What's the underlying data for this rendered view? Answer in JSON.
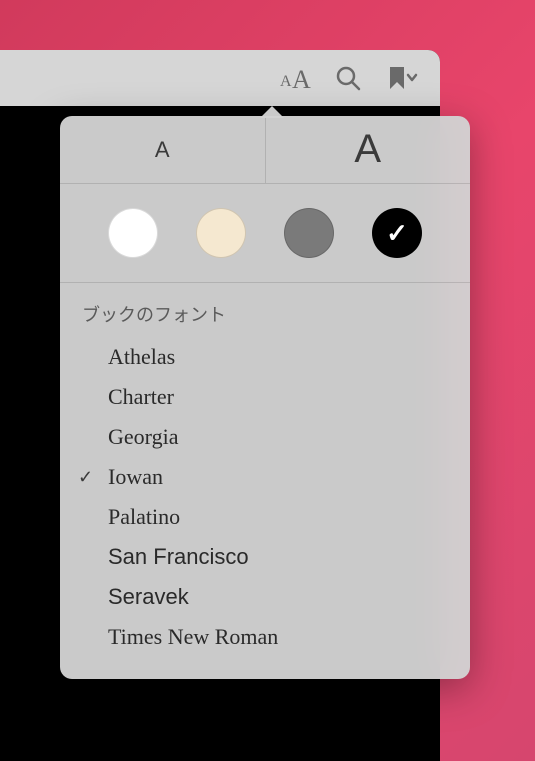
{
  "toolbar": {
    "font_size_label": "AA",
    "search_label": "Search",
    "bookmark_label": "Bookmark"
  },
  "popover": {
    "size_small": "A",
    "size_large": "A",
    "themes": [
      {
        "name": "white",
        "color": "#ffffff",
        "selected": false
      },
      {
        "name": "sepia",
        "color": "#f5e8d0",
        "selected": false
      },
      {
        "name": "gray",
        "color": "#7a7a7a",
        "selected": false
      },
      {
        "name": "black",
        "color": "#000000",
        "selected": true
      }
    ],
    "font_header": "ブックのフォント",
    "fonts": [
      {
        "name": "Athelas",
        "selected": false,
        "class": "font-athelas"
      },
      {
        "name": "Charter",
        "selected": false,
        "class": "font-charter"
      },
      {
        "name": "Georgia",
        "selected": false,
        "class": "font-georgia"
      },
      {
        "name": "Iowan",
        "selected": true,
        "class": "font-iowan"
      },
      {
        "name": "Palatino",
        "selected": false,
        "class": "font-palatino"
      },
      {
        "name": "San Francisco",
        "selected": false,
        "class": "font-sanfrancisco"
      },
      {
        "name": "Seravek",
        "selected": false,
        "class": "font-seravek"
      },
      {
        "name": "Times New Roman",
        "selected": false,
        "class": "font-tnr"
      }
    ],
    "checkmark_glyph": "✓"
  }
}
